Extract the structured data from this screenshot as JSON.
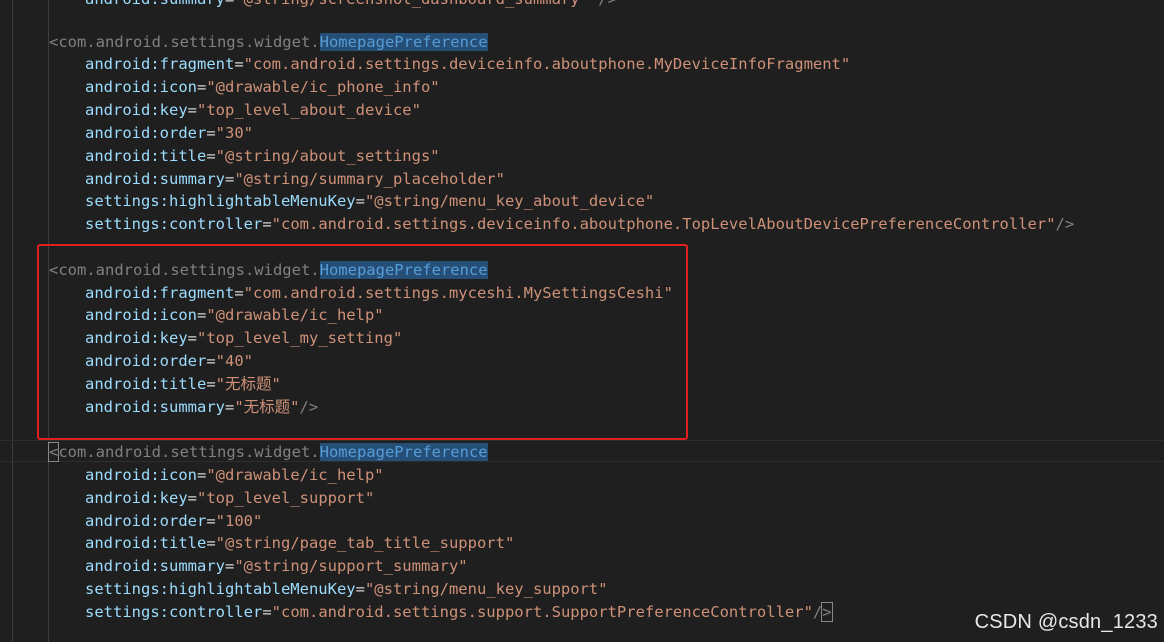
{
  "code": {
    "line0": {
      "attr": "android:summary",
      "value": "\"@string/screenshot_dashboard_summary\"",
      "end": " />"
    },
    "block1": {
      "open_prefix": "<com.android.settings.widget.",
      "open_tag": "HomepagePreference",
      "l1": {
        "attr": "android:fragment",
        "value": "\"com.android.settings.deviceinfo.aboutphone.MyDeviceInfoFragment\""
      },
      "l2": {
        "attr": "android:icon",
        "value": "\"@drawable/ic_phone_info\""
      },
      "l3": {
        "attr": "android:key",
        "value": "\"top_level_about_device\""
      },
      "l4": {
        "attr": "android:order",
        "value": "\"30\""
      },
      "l5": {
        "attr": "android:title",
        "value": "\"@string/about_settings\""
      },
      "l6": {
        "attr": "android:summary",
        "value": "\"@string/summary_placeholder\""
      },
      "l7": {
        "attr": "settings:highlightableMenuKey",
        "value": "\"@string/menu_key_about_device\""
      },
      "l8": {
        "attr": "settings:controller",
        "value": "\"com.android.settings.deviceinfo.aboutphone.TopLevelAboutDevicePreferenceController\"",
        "end": "/>"
      }
    },
    "block2": {
      "open_prefix": "<com.android.settings.widget.",
      "open_tag": "HomepagePreference",
      "l1": {
        "attr": "android:fragment",
        "value": "\"com.android.settings.myceshi.MySettingsCeshi\""
      },
      "l2": {
        "attr": "android:icon",
        "value": "\"@drawable/ic_help\""
      },
      "l3": {
        "attr": "android:key",
        "value": "\"top_level_my_setting\""
      },
      "l4": {
        "attr": "android:order",
        "value": "\"40\""
      },
      "l5": {
        "attr": "android:title",
        "value": "\"无标题\""
      },
      "l6": {
        "attr": "android:summary",
        "value": "\"无标题\"",
        "end": "/>"
      }
    },
    "block3": {
      "open_lt": "<",
      "open_prefix": "com.android.settings.widget.",
      "open_tag": "HomepagePreference",
      "l1": {
        "attr": "android:icon",
        "value": "\"@drawable/ic_help\""
      },
      "l2": {
        "attr": "android:key",
        "value": "\"top_level_support\""
      },
      "l3": {
        "attr": "android:order",
        "value": "\"100\""
      },
      "l4": {
        "attr": "android:title",
        "value": "\"@string/page_tab_title_support\""
      },
      "l5": {
        "attr": "android:summary",
        "value": "\"@string/support_summary\""
      },
      "l6": {
        "attr": "settings:highlightableMenuKey",
        "value": "\"@string/menu_key_support\""
      },
      "l7": {
        "attr": "settings:controller",
        "value": "\"com.android.settings.support.SupportPreferenceController\"",
        "end_slash": "/",
        "end_gt": ">"
      }
    }
  },
  "eq": "=",
  "watermark": "CSDN @csdn_1233",
  "colors": {
    "background": "#1f1f1f",
    "tag": "#569cd6",
    "attribute": "#9cdcfe",
    "string": "#ce9178",
    "highlight_frame": "#e0201e"
  }
}
